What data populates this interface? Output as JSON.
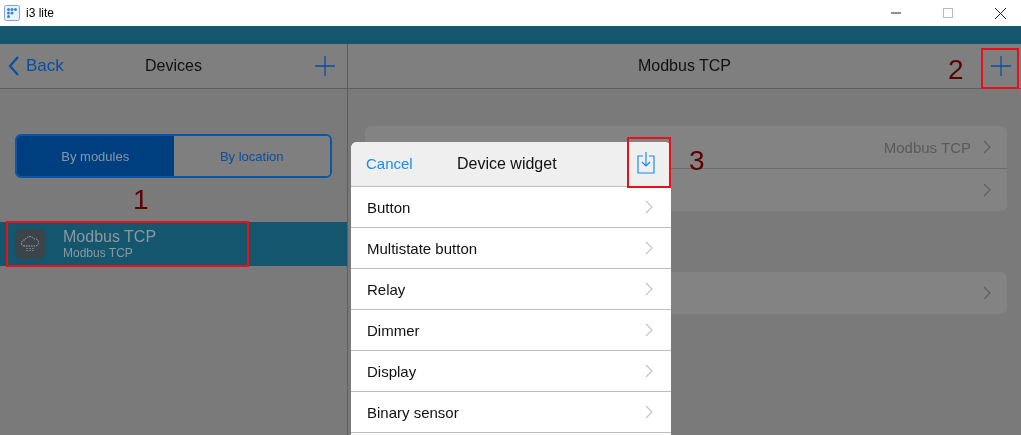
{
  "window": {
    "title": "i3 lite"
  },
  "left_pane": {
    "back": "Back",
    "title": "Devices",
    "segments": [
      {
        "label": "By modules",
        "selected": true
      },
      {
        "label": "By location",
        "selected": false
      }
    ],
    "devices": [
      {
        "name": "Modbus TCP",
        "subtitle": "Modbus TCP",
        "selected": true
      }
    ]
  },
  "right_pane": {
    "title": "Modbus TCP",
    "groups": [
      {
        "rows": [
          {
            "kind": "value",
            "value": "Modbus TCP"
          },
          {
            "kind": "plain"
          }
        ]
      },
      {
        "rows": [
          {
            "kind": "plain"
          }
        ]
      }
    ]
  },
  "dialog": {
    "cancel": "Cancel",
    "title": "Device widget",
    "items": [
      "Button",
      "Multistate button",
      "Relay",
      "Dimmer",
      "Display",
      "Binary sensor"
    ]
  },
  "annotations": [
    {
      "label": "1"
    },
    {
      "label": "2"
    },
    {
      "label": "3"
    }
  ]
}
